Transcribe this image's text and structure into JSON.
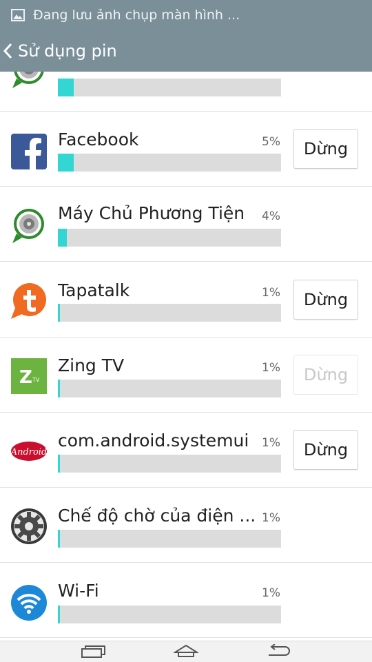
{
  "status": {
    "text": "Đang lưu ảnh chụp màn hình ...",
    "icon": "image-icon"
  },
  "header": {
    "title": "Sử dụng pin",
    "back_icon": "chevron-left-icon"
  },
  "colors": {
    "bar_fill": "#33d6d2",
    "bar_track": "#dcdcdc",
    "header_bg": "#7b8f99"
  },
  "apps": [
    {
      "name": "",
      "percent_text": "",
      "usage": 0.07,
      "icon": "media-server-icon",
      "stop": null
    },
    {
      "name": "Facebook",
      "percent_text": "5%",
      "usage": 0.07,
      "icon": "facebook-icon",
      "stop": {
        "label": "Dừng",
        "enabled": true
      }
    },
    {
      "name": "Máy Chủ Phương Tiện",
      "percent_text": "4%",
      "usage": 0.04,
      "icon": "media-server-icon",
      "stop": null
    },
    {
      "name": "Tapatalk",
      "percent_text": "1%",
      "usage": 0.01,
      "icon": "tapatalk-icon",
      "stop": {
        "label": "Dừng",
        "enabled": true
      }
    },
    {
      "name": "Zing TV",
      "percent_text": "1%",
      "usage": 0.01,
      "icon": "zing-tv-icon",
      "stop": {
        "label": "Dừng",
        "enabled": false
      }
    },
    {
      "name": "com.android.systemui",
      "percent_text": "1%",
      "usage": 0.01,
      "icon": "android-icon",
      "stop": {
        "label": "Dừng",
        "enabled": true
      }
    },
    {
      "name": "Chế độ chờ của điện ...",
      "percent_text": "1%",
      "usage": 0.01,
      "icon": "settings-gear-icon",
      "stop": null
    },
    {
      "name": "Wi-Fi",
      "percent_text": "1%",
      "usage": 0.01,
      "icon": "wifi-icon",
      "stop": null
    }
  ],
  "nav": {
    "recent_icon": "recent-apps-icon",
    "home_icon": "home-icon",
    "back_icon": "back-arrow-icon"
  }
}
